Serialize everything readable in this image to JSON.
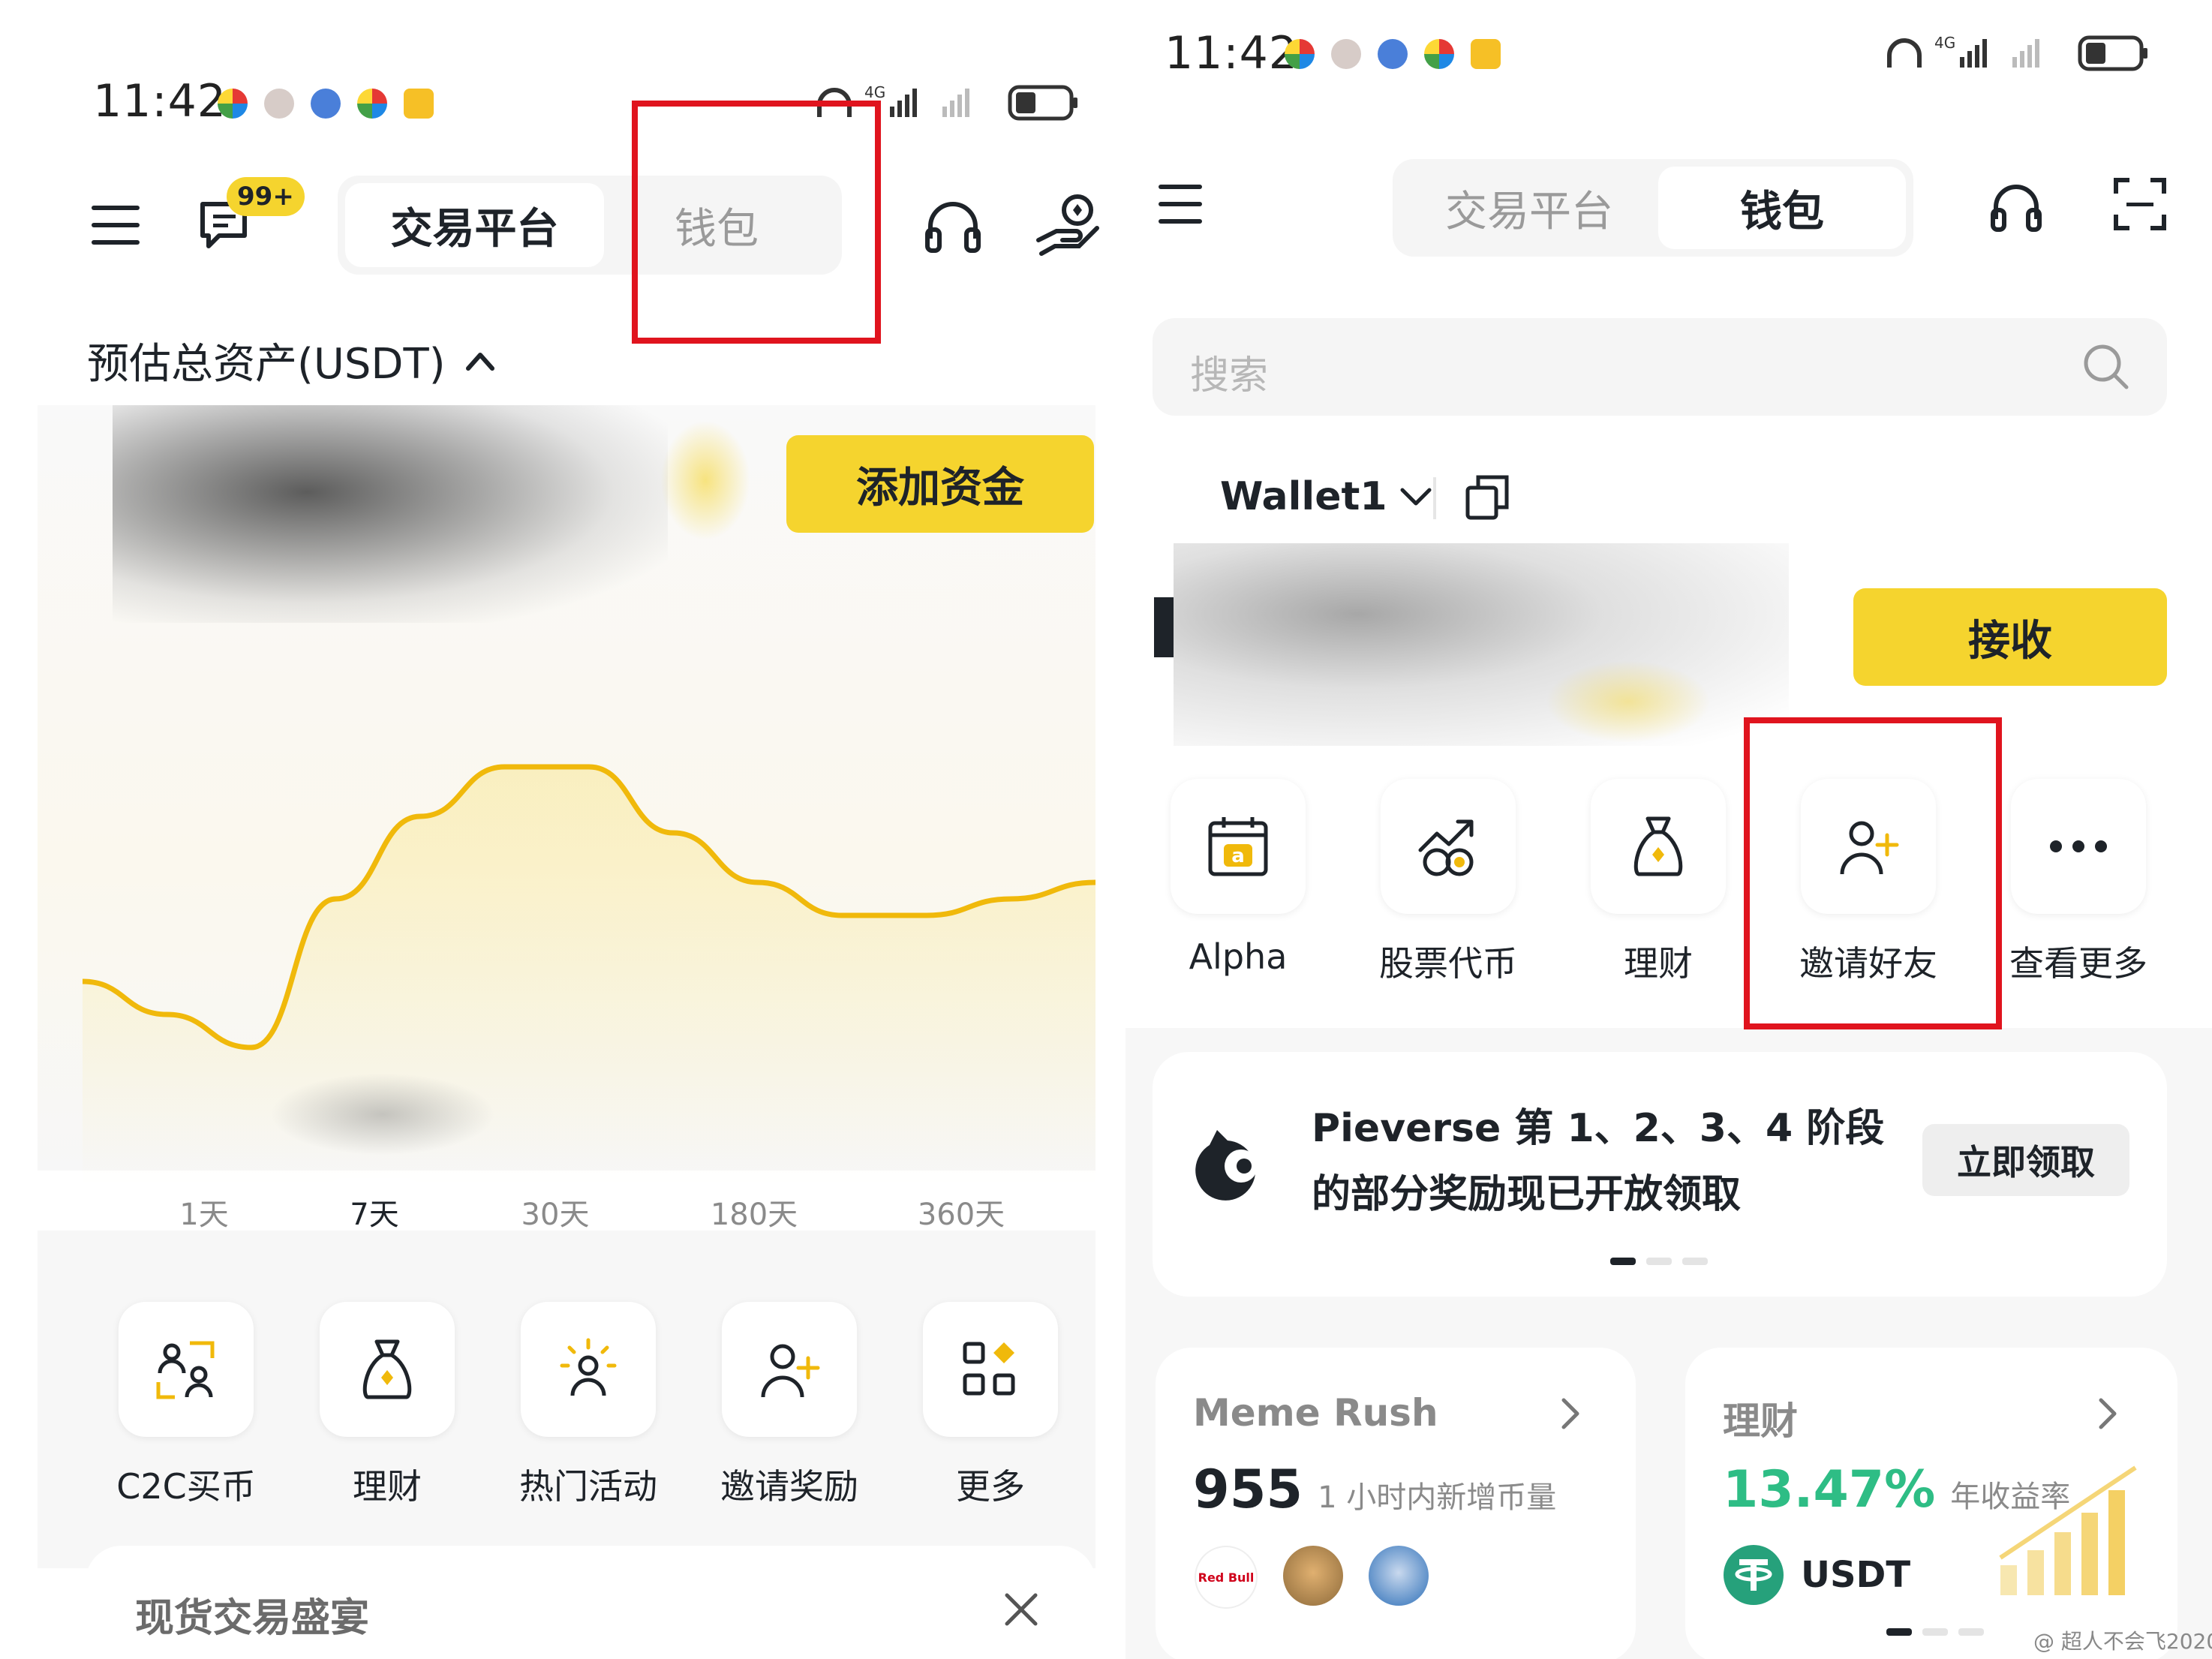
{
  "left": {
    "status": {
      "time": "11:42"
    },
    "header": {
      "message_badge": "99+",
      "tabs": [
        {
          "label": "交易平台",
          "active": true
        },
        {
          "label": "钱包",
          "active": false
        }
      ]
    },
    "assets_label": "预估总资产(USDT)",
    "add_funds_label": "添加资金",
    "chart_data": {
      "type": "line",
      "x": [
        0,
        1,
        2,
        3,
        4,
        5,
        6,
        7,
        8,
        9,
        10,
        11,
        12
      ],
      "values": [
        0.3,
        0.2,
        0.1,
        0.55,
        0.8,
        0.95,
        0.95,
        0.75,
        0.6,
        0.5,
        0.5,
        0.55,
        0.6
      ],
      "color": "#f0b90b"
    },
    "ranges": [
      {
        "label": "1天",
        "active": false
      },
      {
        "label": "7天",
        "active": true
      },
      {
        "label": "30天",
        "active": false
      },
      {
        "label": "180天",
        "active": false
      },
      {
        "label": "360天",
        "active": false
      }
    ],
    "quick_actions": [
      {
        "label": "C2C买币",
        "icon": "c2c-users-icon"
      },
      {
        "label": "理财",
        "icon": "money-bag-icon"
      },
      {
        "label": "热门活动",
        "icon": "person-sparkle-icon"
      },
      {
        "label": "邀请奖励",
        "icon": "person-add-icon"
      },
      {
        "label": "更多",
        "icon": "grid-more-icon"
      }
    ],
    "promo": {
      "title": "现货交易盛宴"
    }
  },
  "right": {
    "status": {
      "time": "11:42"
    },
    "header": {
      "tabs": [
        {
          "label": "交易平台",
          "active": false
        },
        {
          "label": "钱包",
          "active": true
        }
      ]
    },
    "search": {
      "placeholder": "搜索"
    },
    "wallet_name": "Wallet1",
    "receive_label": "接收",
    "quick_actions": [
      {
        "label": "Alpha",
        "icon": "alpha-calendar-icon"
      },
      {
        "label": "股票代币",
        "icon": "stock-token-icon"
      },
      {
        "label": "理财",
        "icon": "money-bag-icon"
      },
      {
        "label": "邀请好友",
        "icon": "person-add-icon"
      },
      {
        "label": "查看更多",
        "icon": "more-dots-icon"
      }
    ],
    "announcement": {
      "line1": "Pieverse 第 1、2、3、4 阶段",
      "line2": "的部分奖励现已开放领取",
      "button": "立即领取"
    },
    "meme_card": {
      "title": "Meme Rush",
      "count": "955",
      "sub": "1 小时内新增币量",
      "token_label": "Red Bull"
    },
    "earn_card": {
      "title": "理财",
      "apy": "13.47%",
      "apy_label": "年收益率",
      "token": "USDT"
    }
  },
  "watermark": "@ 超人不会飞2020",
  "colors": {
    "accent": "#f5d42e",
    "chart": "#f0b90b",
    "highlight": "#e0141e",
    "green": "#2ebd85"
  }
}
